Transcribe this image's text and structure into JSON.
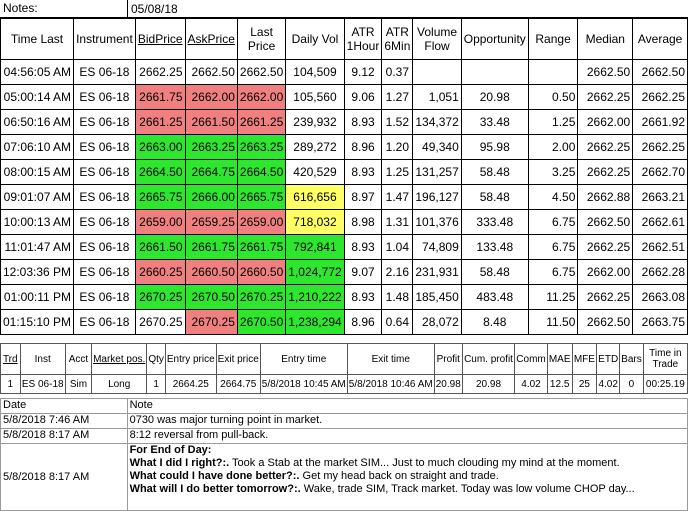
{
  "notes_label": "Notes:",
  "notes_date": "05/08/18",
  "headers": {
    "time_last": "Time Last",
    "instrument": "Instrument",
    "bid": "BidPrice",
    "ask": "AskPrice",
    "last_price": "Last Price",
    "daily_vol": "Daily Vol",
    "atr1": "ATR 1Hour",
    "atr6": "ATR 6Min",
    "volume_flow": "Volume Flow",
    "opportunity": "Opportunity",
    "range": "Range",
    "median": "Median",
    "average": "Average"
  },
  "colors": {
    "red": "#f08080",
    "green": "#2ee62e",
    "yellow": "#ffff66"
  },
  "rows": [
    {
      "time": "04:56:05 AM",
      "inst": "ES 06-18",
      "bid": "2662.25",
      "ask": "2662.50",
      "last": "2662.50",
      "vol": "104,509",
      "atr1": "9.12",
      "atr6": "0.37",
      "flow": "",
      "opp": "",
      "range": "",
      "median": "2662.50",
      "avg": "2662.50",
      "bidc": "",
      "askc": "",
      "lastc": "",
      "volc": ""
    },
    {
      "time": "05:00:14 AM",
      "inst": "ES 06-18",
      "bid": "2661.75",
      "ask": "2662.00",
      "last": "2662.00",
      "vol": "105,560",
      "atr1": "9.06",
      "atr6": "1.27",
      "flow": "1,051",
      "opp": "20.98",
      "range": "0.50",
      "median": "2662.25",
      "avg": "2662.25",
      "bidc": "red",
      "askc": "red",
      "lastc": "red",
      "volc": ""
    },
    {
      "time": "06:50:16 AM",
      "inst": "ES 06-18",
      "bid": "2661.25",
      "ask": "2661.50",
      "last": "2661.25",
      "vol": "239,932",
      "atr1": "8.93",
      "atr6": "1.52",
      "flow": "134,372",
      "opp": "33.48",
      "range": "1.25",
      "median": "2662.00",
      "avg": "2661.92",
      "bidc": "red",
      "askc": "red",
      "lastc": "red",
      "volc": ""
    },
    {
      "time": "07:06:10 AM",
      "inst": "ES 06-18",
      "bid": "2663.00",
      "ask": "2663.25",
      "last": "2663.25",
      "vol": "289,272",
      "atr1": "8.96",
      "atr6": "1.20",
      "flow": "49,340",
      "opp": "95.98",
      "range": "2.00",
      "median": "2662.25",
      "avg": "2662.25",
      "bidc": "green",
      "askc": "green",
      "lastc": "green",
      "volc": ""
    },
    {
      "time": "08:00:15 AM",
      "inst": "ES 06-18",
      "bid": "2664.50",
      "ask": "2664.75",
      "last": "2664.50",
      "vol": "420,529",
      "atr1": "8.93",
      "atr6": "1.25",
      "flow": "131,257",
      "opp": "58.48",
      "range": "3.25",
      "median": "2662.25",
      "avg": "2662.70",
      "bidc": "green",
      "askc": "green",
      "lastc": "green",
      "volc": ""
    },
    {
      "time": "09:01:07 AM",
      "inst": "ES 06-18",
      "bid": "2665.75",
      "ask": "2666.00",
      "last": "2665.75",
      "vol": "616,656",
      "atr1": "8.97",
      "atr6": "1.47",
      "flow": "196,127",
      "opp": "58.48",
      "range": "4.50",
      "median": "2662.88",
      "avg": "2663.21",
      "bidc": "green",
      "askc": "green",
      "lastc": "green",
      "volc": "yellow"
    },
    {
      "time": "10:00:13 AM",
      "inst": "ES 06-18",
      "bid": "2659.00",
      "ask": "2659.25",
      "last": "2659.00",
      "vol": "718,032",
      "atr1": "8.98",
      "atr6": "1.31",
      "flow": "101,376",
      "opp": "333.48",
      "range": "6.75",
      "median": "2662.50",
      "avg": "2662.61",
      "bidc": "red",
      "askc": "red",
      "lastc": "red",
      "volc": "yellow"
    },
    {
      "time": "11:01:47 AM",
      "inst": "ES 06-18",
      "bid": "2661.50",
      "ask": "2661.75",
      "last": "2661.75",
      "vol": "792,841",
      "atr1": "8.93",
      "atr6": "1.04",
      "flow": "74,809",
      "opp": "133.48",
      "range": "6.75",
      "median": "2662.25",
      "avg": "2662.51",
      "bidc": "green",
      "askc": "green",
      "lastc": "green",
      "volc": "green"
    },
    {
      "time": "12:03:36 PM",
      "inst": "ES 06-18",
      "bid": "2660.25",
      "ask": "2660.50",
      "last": "2660.50",
      "vol": "1,024,772",
      "atr1": "9.07",
      "atr6": "2.16",
      "flow": "231,931",
      "opp": "58.48",
      "range": "6.75",
      "median": "2662.00",
      "avg": "2662.28",
      "bidc": "red",
      "askc": "red",
      "lastc": "red",
      "volc": "green"
    },
    {
      "time": "01:00:11 PM",
      "inst": "ES 06-18",
      "bid": "2670.25",
      "ask": "2670.50",
      "last": "2670.25",
      "vol": "1,210,222",
      "atr1": "8.93",
      "atr6": "1.48",
      "flow": "185,450",
      "opp": "483.48",
      "range": "11.25",
      "median": "2662.25",
      "avg": "2663.08",
      "bidc": "green",
      "askc": "green",
      "lastc": "green",
      "volc": "green"
    },
    {
      "time": "01:15:10 PM",
      "inst": "ES 06-18",
      "bid": "2670.25",
      "ask": "2670.25",
      "last": "2670.50",
      "vol": "1,238,294",
      "atr1": "8.96",
      "atr6": "0.64",
      "flow": "28,072",
      "opp": "8.48",
      "range": "11.50",
      "median": "2662.50",
      "avg": "2663.75",
      "bidc": "",
      "askc": "red",
      "lastc": "green",
      "volc": "green"
    }
  ],
  "trade_headers": {
    "trd": "Trd",
    "inst": "Inst",
    "acct": "Acct",
    "mpos": "Market pos.",
    "qty": "Qty",
    "entry_price": "Entry price",
    "exit_price": "Exit price",
    "entry_time": "Entry time",
    "exit_time": "Exit time",
    "profit": "Profit",
    "cum_profit": "Cum. profit",
    "comm": "Comm",
    "mae": "MAE",
    "mfe": "MFE",
    "etd": "ETD",
    "bars": "Bars",
    "time_in_trade": "Time in Trade"
  },
  "trades": [
    {
      "trd": "1",
      "inst": "ES 06-18",
      "acct": "Sim",
      "mpos": "Long",
      "qty": "1",
      "entry_price": "2664.25",
      "exit_price": "2664.75",
      "entry_time": "5/8/2018 10:45 AM",
      "exit_time": "5/8/2018 10:46 AM",
      "profit": "20.98",
      "cum_profit": "20.98",
      "comm": "4.02",
      "mae": "12.5",
      "mfe": "25",
      "etd": "4.02",
      "bars": "0",
      "time_in_trade": "00:25.19"
    }
  ],
  "journal": {
    "date_header": "Date",
    "note_header": "Note",
    "entries": [
      {
        "date": "5/8/2018 7:46 AM",
        "note": "0730 was major turning point in market."
      },
      {
        "date": "5/8/2018 8:17 AM",
        "note": "8:12 reversal from pull-back."
      }
    ],
    "eod": {
      "date": "5/8/2018 8:17 AM",
      "title": "For End of Day:",
      "q1": "What I did I right?:.",
      "a1": " Took a Stab at the market SIM... Just to much clouding my mind at the moment.",
      "q2": "What could I have done better?:.",
      "a2": " Get my head back on straight and trade.",
      "q3": "What will I do better tomorrow?:.",
      "a3": " Wake, trade SIM, Track market.  Today was low volume CHOP day..."
    }
  }
}
